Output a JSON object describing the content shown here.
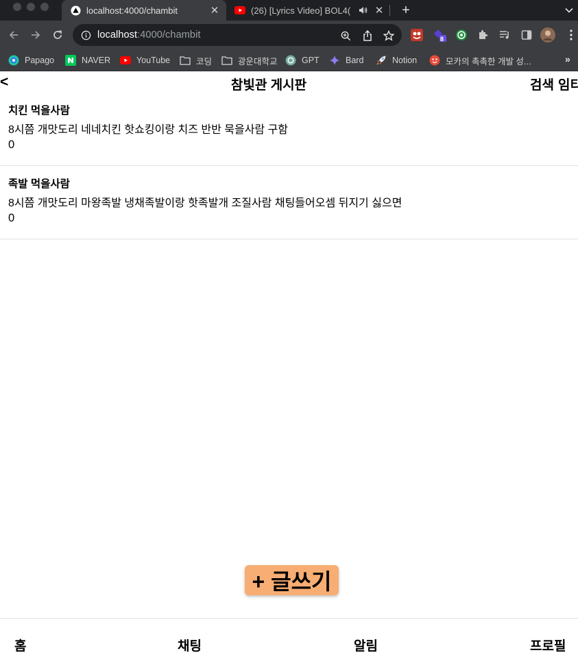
{
  "browser": {
    "tabs": [
      {
        "title": "localhost:4000/chambit",
        "active": true
      },
      {
        "title": "(26) [Lyrics Video] BOL4(",
        "active": false
      }
    ],
    "url_host": "localhost",
    "url_path": ":4000/chambit",
    "extension_badge": "8",
    "bookmarks": [
      {
        "label": "Papago",
        "icon": "papago-icon"
      },
      {
        "label": "NAVER",
        "icon": "naver-icon"
      },
      {
        "label": "YouTube",
        "icon": "youtube-icon"
      },
      {
        "label": "코딩",
        "icon": "folder-icon"
      },
      {
        "label": "광운대학교",
        "icon": "folder-icon"
      },
      {
        "label": "GPT",
        "icon": "gpt-icon"
      },
      {
        "label": "Bard",
        "icon": "bard-icon"
      },
      {
        "label": "Notion",
        "icon": "rocket-icon"
      },
      {
        "label": "모카의 촉촉한 개발 성...",
        "icon": "blog-icon"
      }
    ],
    "bookmarks_more": "»"
  },
  "app": {
    "back_label": "<",
    "title": "참빛관 게시판",
    "actions": [
      "검색",
      "임티"
    ]
  },
  "posts": [
    {
      "title": "치킨 먹을사람",
      "body": "8시쯤 개맛도리 네네치킨 핫쇼킹이랑 치즈 반반 묵을사람 구함",
      "count": "0"
    },
    {
      "title": "족발 먹을사람",
      "body": "8시쯤 개맛도리 마왕족발 냉채족발이랑 핫족발개 조질사람 채팅들어오셈 뒤지기 싫으면",
      "count": "0"
    }
  ],
  "write_button": "+ 글쓰기",
  "bottom_nav": [
    "홈",
    "채팅",
    "알림",
    "프로필"
  ],
  "colors": {
    "write_button_bg": "#f7ad73",
    "chrome_dark": "#1f2023",
    "chrome_toolbar": "#3c3d40"
  }
}
